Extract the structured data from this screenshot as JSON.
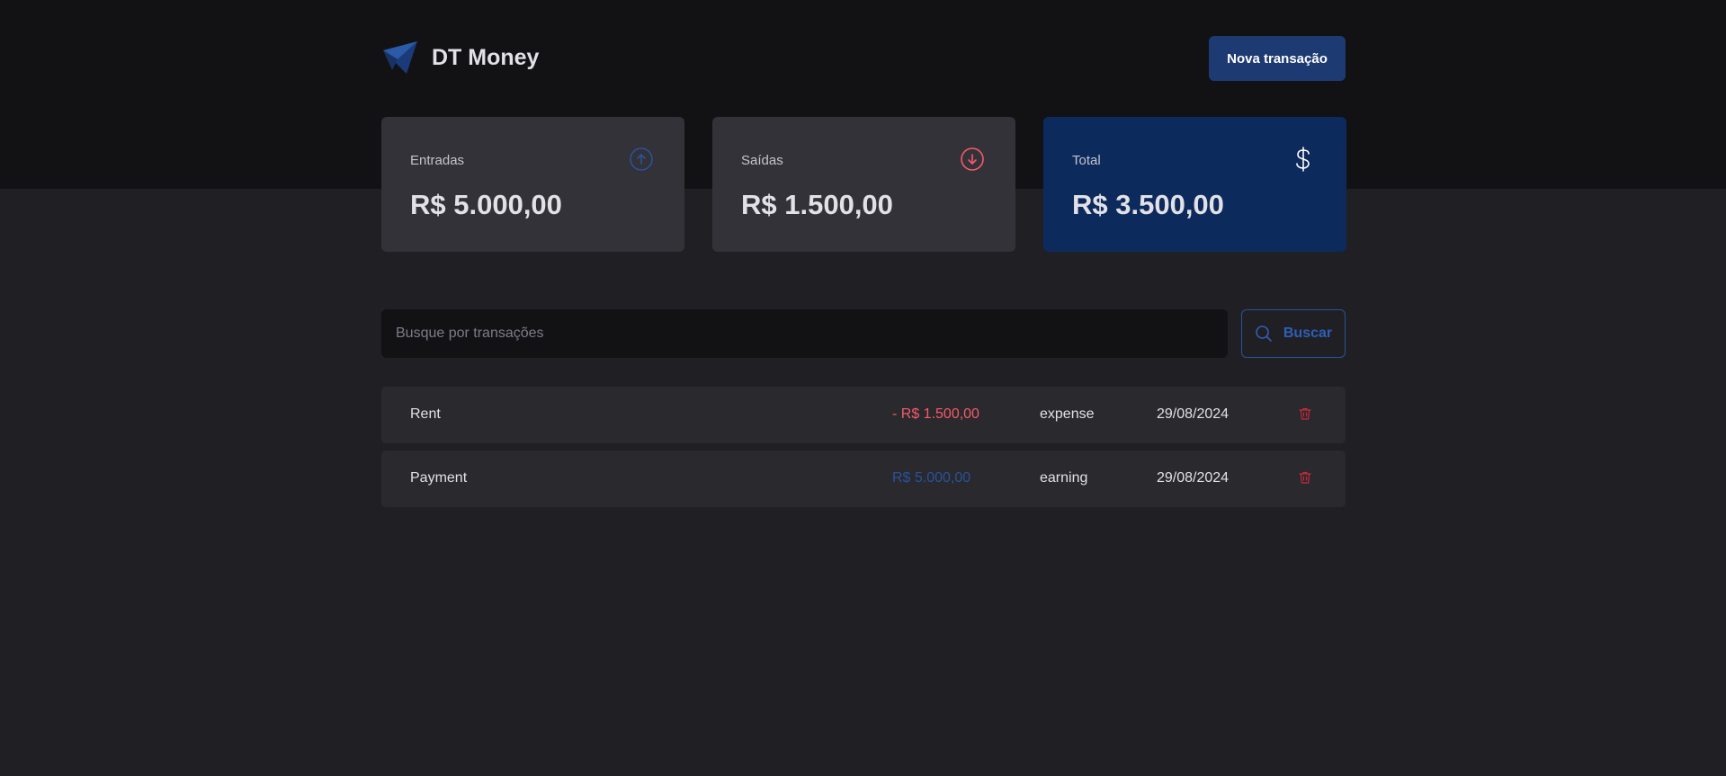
{
  "app": {
    "name": "DT Money",
    "new_transaction_label": "Nova transação"
  },
  "summary": {
    "income": {
      "label": "Entradas",
      "value": "R$ 5.000,00",
      "icon": "arrow-circle-up-icon"
    },
    "outcome": {
      "label": "Saídas",
      "value": "R$ 1.500,00",
      "icon": "arrow-circle-down-icon"
    },
    "total": {
      "label": "Total",
      "value": "R$ 3.500,00",
      "icon": "dollar-sign-icon"
    }
  },
  "search": {
    "placeholder": "Busque por transações",
    "button_label": "Buscar"
  },
  "transactions": [
    {
      "description": "Rent",
      "amount": "- R$ 1.500,00",
      "type": "expense",
      "category": "expense",
      "date": "29/08/2024"
    },
    {
      "description": "Payment",
      "amount": "R$ 5.000,00",
      "type": "earning",
      "category": "earning",
      "date": "29/08/2024"
    }
  ],
  "colors": {
    "brand": "#1d3a72",
    "income": "#2a5298",
    "outcome": "#f75a68",
    "total_card": "#0d2a5c"
  }
}
